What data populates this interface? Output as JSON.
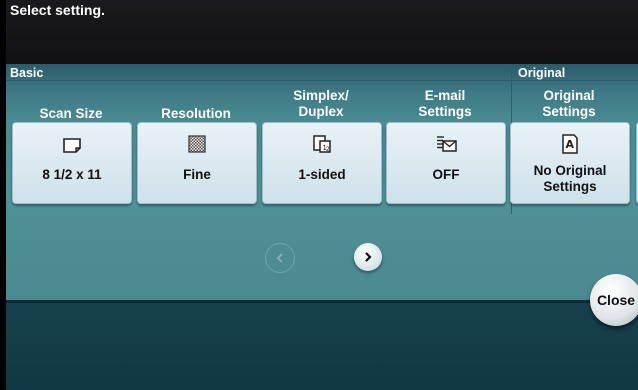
{
  "header": {
    "prompt": "Select setting."
  },
  "groups": {
    "basic": "Basic",
    "original": "Original"
  },
  "settings": [
    {
      "label": "Scan Size",
      "value": "8 1/2 x 11",
      "icon": "paper-size-icon"
    },
    {
      "label": "Resolution",
      "value": "Fine",
      "icon": "resolution-icon"
    },
    {
      "label": "Simplex/\nDuplex",
      "value": "1-sided",
      "icon": "simplex-duplex-icon"
    },
    {
      "label": "E-mail\nSettings",
      "value": "OFF",
      "icon": "email-settings-icon"
    },
    {
      "label": "Original\nSettings",
      "value": "No Original\nSettings",
      "icon": "original-settings-icon"
    }
  ],
  "nav": {
    "prev": "prev-page-icon",
    "next": "next-page-icon"
  },
  "close_label": "Close",
  "colors": {
    "panel": "#4b8c92",
    "tile": "#dceaf0",
    "topbar": "#1b1b1f"
  }
}
